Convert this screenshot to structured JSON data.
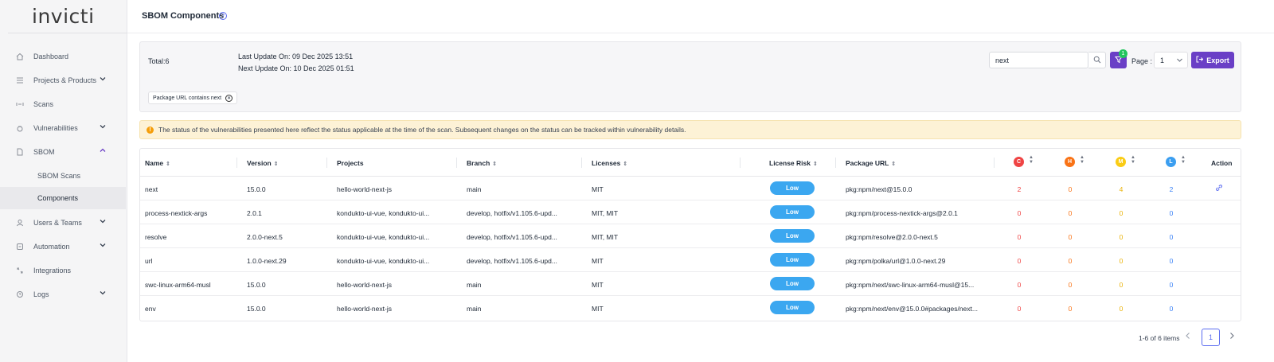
{
  "sidebar": {
    "logo": "invicti",
    "items": [
      {
        "label": "Dashboard",
        "icon": "home-icon"
      },
      {
        "label": "Projects & Products",
        "icon": "list-icon"
      },
      {
        "label": "Scans",
        "icon": "scan-icon"
      },
      {
        "label": "Vulnerabilities",
        "icon": "bug-icon"
      },
      {
        "label": "SBOM",
        "icon": "file-icon"
      },
      {
        "label": "Users & Teams",
        "icon": "users-icon"
      },
      {
        "label": "Automation",
        "icon": "automation-icon"
      },
      {
        "label": "Integrations",
        "icon": "integration-icon"
      },
      {
        "label": "Logs",
        "icon": "logs-icon"
      }
    ],
    "sbom_sub": [
      {
        "label": "SBOM Scans"
      },
      {
        "label": "Components"
      }
    ]
  },
  "header": {
    "title": "SBOM Components"
  },
  "info": {
    "total": "Total:6",
    "last_update": "Last Update On: 09 Dec 2025 13:51",
    "next_update": "Next Update On: 10 Dec 2025 01:51",
    "search_value": "next",
    "filter_count": "1",
    "page_label": "Page :",
    "page_value": "1",
    "export_label": "Export",
    "chip_label": "Package URL contains next"
  },
  "alert": {
    "text": "The status of the vulnerabilities presented here reflect the status applicable at the time of the scan. Subsequent changes on the status can be tracked within vulnerability details."
  },
  "table": {
    "headers": {
      "name": "Name",
      "version": "Version",
      "projects": "Projects",
      "branch": "Branch",
      "licenses": "Licenses",
      "license_risk": "License Risk",
      "package_url": "Package URL",
      "critical": "C",
      "high": "H",
      "medium": "M",
      "low": "L",
      "action": "Action"
    },
    "rows": [
      {
        "name": "next",
        "version": "15.0.0",
        "projects": "hello-world-next-js",
        "branch": "main",
        "licenses": "MIT",
        "risk": "Low",
        "purl": "pkg:npm/next@15.0.0",
        "c": "2",
        "h": "0",
        "m": "4",
        "l": "2"
      },
      {
        "name": "process-nextick-args",
        "version": "2.0.1",
        "projects": "kondukto-ui-vue, kondukto-ui...",
        "branch": "develop, hotfix/v1.105.6-upd...",
        "licenses": "MIT, MIT",
        "risk": "Low",
        "purl": "pkg:npm/process-nextick-args@2.0.1",
        "c": "0",
        "h": "0",
        "m": "0",
        "l": "0"
      },
      {
        "name": "resolve",
        "version": "2.0.0-next.5",
        "projects": "kondukto-ui-vue, kondukto-ui...",
        "branch": "develop, hotfix/v1.105.6-upd...",
        "licenses": "MIT, MIT",
        "risk": "Low",
        "purl": "pkg:npm/resolve@2.0.0-next.5",
        "c": "0",
        "h": "0",
        "m": "0",
        "l": "0"
      },
      {
        "name": "url",
        "version": "1.0.0-next.29",
        "projects": "kondukto-ui-vue, kondukto-ui...",
        "branch": "develop, hotfix/v1.105.6-upd...",
        "licenses": "MIT",
        "risk": "Low",
        "purl": "pkg:npm/polka/url@1.0.0-next.29",
        "c": "0",
        "h": "0",
        "m": "0",
        "l": "0"
      },
      {
        "name": "swc-linux-arm64-musl",
        "version": "15.0.0",
        "projects": "hello-world-next-js",
        "branch": "main",
        "licenses": "MIT",
        "risk": "Low",
        "purl": "pkg:npm/next/swc-linux-arm64-musl@15...",
        "c": "0",
        "h": "0",
        "m": "0",
        "l": "0"
      },
      {
        "name": "env",
        "version": "15.0.0",
        "projects": "hello-world-next-js",
        "branch": "main",
        "licenses": "MIT",
        "risk": "Low",
        "purl": "pkg:npm/next/env@15.0.0#packages/next...",
        "c": "0",
        "h": "0",
        "m": "0",
        "l": "0"
      }
    ]
  },
  "pagination": {
    "items_text": "1-6 of 6 items",
    "current_page": "1"
  },
  "colors": {
    "accent": "#6a3fc6",
    "risk_low": "#3ba7f0",
    "critical": "#ef4444",
    "high": "#f97316",
    "medium": "#eab308",
    "low": "#3b82f6"
  }
}
